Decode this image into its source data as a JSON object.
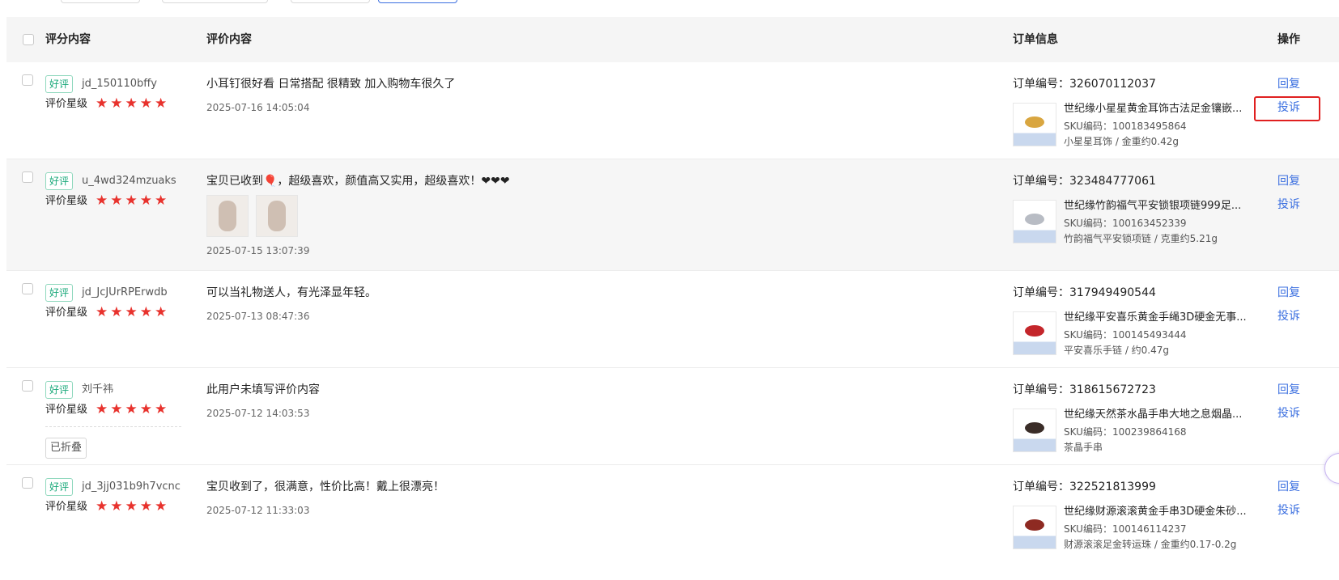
{
  "columns": {
    "rating": "评分内容",
    "review": "评价内容",
    "order": "订单信息",
    "action": "操作"
  },
  "labels": {
    "star_rating": "评价星级",
    "stars": "★★★★★",
    "order_prefix": "订单编号：",
    "reply": "回复",
    "complain": "投诉",
    "folded": "已折叠"
  },
  "rows": [
    {
      "tag": "好评",
      "user": "jd_150110bffy",
      "content": "小耳钉很好看 日常搭配 很精致 加入购物车很久了",
      "time": "2025-07-16 14:05:04",
      "order_no": "326070112037",
      "product": "世纪缘小星星黄金耳饰古法足金镶嵌...",
      "sku": "SKU编码：100183495864",
      "spec": "小星星耳饰 / 金重约0.42g",
      "thumb_color": "#d9a640"
    },
    {
      "tag": "好评",
      "user": "u_4wd324mzuaks",
      "content": "宝贝已收到🎈，超级喜欢，颜值高又实用，超级喜欢！❤❤❤",
      "time": "2025-07-15 13:07:39",
      "order_no": "323484777061",
      "product": "世纪缘竹韵福气平安锁银项链999足...",
      "sku": "SKU编码：100163452339",
      "spec": "竹韵福气平安锁项链 / 克重约5.21g",
      "thumb_color": "#b8bcc4"
    },
    {
      "tag": "好评",
      "user": "jd_JcJUrRPErwdb",
      "content": "可以当礼物送人，有光泽显年轻。",
      "time": "2025-07-13 08:47:36",
      "order_no": "317949490544",
      "product": "世纪缘平安喜乐黄金手绳3D硬金无事...",
      "sku": "SKU编码：100145493444",
      "spec": "平安喜乐手链 / 约0.47g",
      "thumb_color": "#c4262b"
    },
    {
      "tag": "好评",
      "user": "刘千祎",
      "content": "此用户未填写评价内容",
      "time": "2025-07-12 14:03:53",
      "order_no": "318615672723",
      "product": "世纪缘天然茶水晶手串大地之息烟晶...",
      "sku": "SKU编码：100239864168",
      "spec": "茶晶手串",
      "thumb_color": "#3a2d28"
    },
    {
      "tag": "好评",
      "user": "jd_3jj031b9h7vcnc",
      "content": "宝贝收到了，很满意，性价比高！戴上很漂亮！",
      "time": "2025-07-12 11:33:03",
      "order_no": "322521813999",
      "product": "世纪缘财源滚滚黄金手串3D硬金朱砂...",
      "sku": "SKU编码：100146114237",
      "spec": "财源滚滚足金转运珠 / 金重约0.17-0.2g",
      "thumb_color": "#8e2a22"
    }
  ]
}
